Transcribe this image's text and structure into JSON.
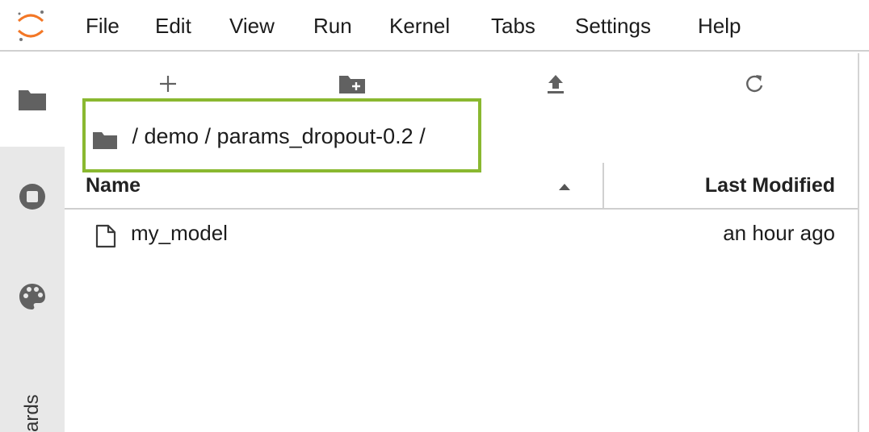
{
  "menu": {
    "items": [
      {
        "label": "File"
      },
      {
        "label": "Edit"
      },
      {
        "label": "View"
      },
      {
        "label": "Run"
      },
      {
        "label": "Kernel"
      },
      {
        "label": "Tabs"
      },
      {
        "label": "Settings"
      },
      {
        "label": "Help"
      }
    ]
  },
  "sidebar": {
    "tabs": [
      {
        "icon": "folder-icon",
        "active": true
      },
      {
        "icon": "running-icon",
        "active": false
      },
      {
        "icon": "palette-icon",
        "active": false
      }
    ],
    "bottom_label": "ards"
  },
  "toolbar": {
    "buttons": [
      {
        "icon": "plus-icon"
      },
      {
        "icon": "new-folder-icon"
      },
      {
        "icon": "upload-icon"
      },
      {
        "icon": "refresh-icon"
      }
    ]
  },
  "breadcrumb": {
    "path": " / demo / params_dropout-0.2 /",
    "highlight_color": "#8ab830"
  },
  "file_list": {
    "columns": {
      "name": "Name",
      "modified": "Last Modified",
      "sort": "ascending"
    },
    "rows": [
      {
        "name": "my_model",
        "modified": "an hour ago",
        "icon": "file-icon"
      }
    ]
  },
  "colors": {
    "logo_accent": "#f37726",
    "sidebar_bg": "#e8e8e8",
    "icon": "#616161"
  }
}
